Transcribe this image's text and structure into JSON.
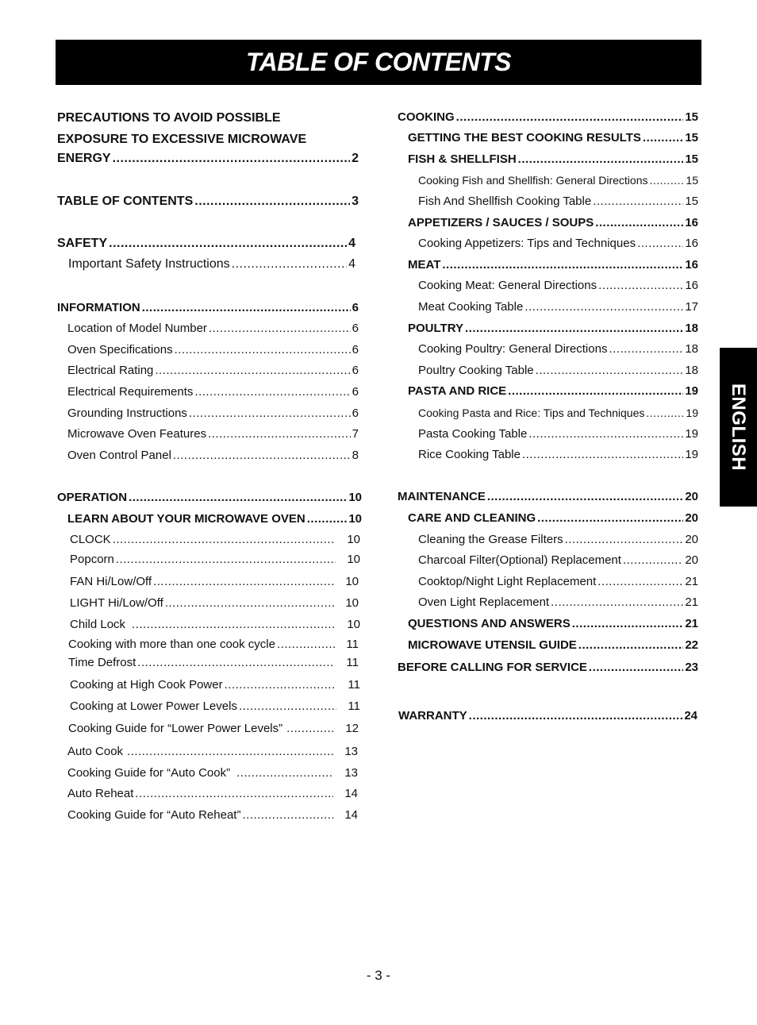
{
  "header": {
    "title": "TABLE OF CONTENTS"
  },
  "side_tab": {
    "label": "ENGLISH"
  },
  "footer": {
    "page_number": "- 3 -"
  },
  "left_column": {
    "precautions": {
      "line1": "PRECAUTIONS TO AVOID POSSIBLE",
      "line2": "EXPOSURE TO EXCESSIVE MICROWAVE",
      "line3": "ENERGY",
      "page": "2"
    },
    "entries": [
      {
        "label": "TABLE OF CONTENTS",
        "page": "3"
      },
      {
        "label": "SAFETY",
        "page": "4"
      },
      {
        "label": "Important Safety Instructions",
        "page": "4"
      },
      {
        "label": "INFORMATION",
        "page": "6"
      },
      {
        "label": "Location of Model Number",
        "page": "6"
      },
      {
        "label": "Oven Specifications",
        "page": "6"
      },
      {
        "label": "Electrical Rating",
        "page": "6"
      },
      {
        "label": "Electrical Requirements",
        "page": "6"
      },
      {
        "label": "Grounding Instructions",
        "page": "6"
      },
      {
        "label": "Microwave Oven Features",
        "page": "7"
      },
      {
        "label": "Oven Control Panel",
        "page": "8"
      },
      {
        "label": "OPERATION",
        "page": "10"
      },
      {
        "label": "LEARN ABOUT YOUR MICROWAVE OVEN",
        "page": "10"
      },
      {
        "label": "CLOCK",
        "page": "10"
      },
      {
        "label": "Popcorn",
        "page": "10"
      },
      {
        "label": "FAN Hi/Low/Off",
        "page": "10"
      },
      {
        "label": "LIGHT Hi/Low/Off",
        "page": "10"
      },
      {
        "label": "Child Lock",
        "page": "10"
      },
      {
        "label": "Cooking with more than one cook cycle",
        "page": "11"
      },
      {
        "label": "Time Defrost",
        "page": "11"
      },
      {
        "label": "Cooking at High Cook Power",
        "page": "11"
      },
      {
        "label": "Cooking at Lower Power Levels",
        "page": "11"
      },
      {
        "label": "Cooking Guide for “Lower Power Levels”",
        "page": "12"
      },
      {
        "label": "Auto Cook",
        "page": "13"
      },
      {
        "label": "Cooking Guide for “Auto Cook”",
        "page": "13"
      },
      {
        "label": "Auto Reheat",
        "page": "14"
      },
      {
        "label": "Cooking Guide for “Auto Reheat”",
        "page": "14"
      }
    ]
  },
  "right_column": {
    "entries": [
      {
        "label": "COOKING",
        "page": "15"
      },
      {
        "label": "GETTING THE BEST COOKING RESULTS",
        "page": "15"
      },
      {
        "label": "FISH & SHELLFISH",
        "page": "15"
      },
      {
        "label": "Cooking Fish and Shellfish: General Directions",
        "page": "15"
      },
      {
        "label": "Fish And Shellfish Cooking Table",
        "page": "15"
      },
      {
        "label": "APPETIZERS / SAUCES / SOUPS",
        "page": "16"
      },
      {
        "label": "Cooking Appetizers: Tips and Techniques",
        "page": "16"
      },
      {
        "label": "MEAT",
        "page": "16"
      },
      {
        "label": "Cooking Meat: General Directions",
        "page": "16"
      },
      {
        "label": "Meat Cooking Table",
        "page": "17"
      },
      {
        "label": "POULTRY",
        "page": "18"
      },
      {
        "label": "Cooking Poultry: General Directions",
        "page": "18"
      },
      {
        "label": "Poultry Cooking Table",
        "page": "18"
      },
      {
        "label": "PASTA AND RICE",
        "page": "19"
      },
      {
        "label": "Cooking Pasta and Rice: Tips and Techniques",
        "page": "19"
      },
      {
        "label": "Pasta Cooking Table",
        "page": "19"
      },
      {
        "label": "Rice Cooking Table",
        "page": "19"
      },
      {
        "label": "MAINTENANCE",
        "page": "20"
      },
      {
        "label": "CARE AND CLEANING",
        "page": "20"
      },
      {
        "label": "Cleaning the Grease Filters",
        "page": "20"
      },
      {
        "label": "Charcoal Filter(Optional) Replacement",
        "page": "20"
      },
      {
        "label": "Cooktop/Night Light Replacement",
        "page": "21"
      },
      {
        "label": "Oven Light Replacement",
        "page": "21"
      },
      {
        "label": "QUESTIONS AND ANSWERS",
        "page": "21"
      },
      {
        "label": "MICROWAVE UTENSIL GUIDE",
        "page": "22"
      },
      {
        "label": "BEFORE CALLING FOR SERVICE",
        "page": "23"
      },
      {
        "label": "WARRANTY",
        "page": "24"
      }
    ]
  }
}
